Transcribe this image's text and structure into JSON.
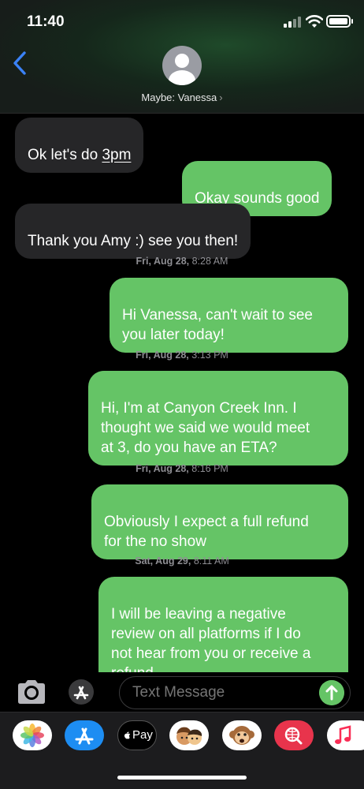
{
  "status_bar": {
    "time": "11:40"
  },
  "header": {
    "contact_name": "Maybe: Vanessa",
    "chevron": "›"
  },
  "messages": [
    {
      "direction": "incoming",
      "text": "Ok let's do ",
      "text_link": "3pm"
    },
    {
      "direction": "outgoing",
      "text": "Okay sounds good"
    },
    {
      "direction": "incoming",
      "text": "Thank you Amy :) see you then!"
    },
    {
      "direction": "outgoing",
      "day": "Fri, Aug 28,",
      "time": "8:28 AM",
      "text": "Hi Vanessa, can't wait to see\nyou later today!"
    },
    {
      "direction": "outgoing",
      "day": "Fri, Aug 28,",
      "time": "3:13 PM",
      "text": "Hi, I'm at Canyon Creek Inn. I\nthought we said we would meet\nat 3, do you have an ETA?"
    },
    {
      "direction": "outgoing",
      "day": "Fri, Aug 28,",
      "time": "8:16 PM",
      "text": "Obviously I expect a full refund\nfor the no show"
    },
    {
      "direction": "outgoing",
      "day": "Sat, Aug 29,",
      "time": "8:11 AM",
      "text": "I will be leaving a negative\nreview on all platforms if I do\nnot hear from you or receive a\nrefund"
    }
  ],
  "input": {
    "placeholder": "Text Message"
  },
  "app_drawer": {
    "apps": [
      {
        "icon": "photos-icon"
      },
      {
        "icon": "app-store-icon"
      },
      {
        "icon": "apple-pay-icon",
        "label": "Pay"
      },
      {
        "icon": "memoji-icon"
      },
      {
        "icon": "animoji-icon"
      },
      {
        "icon": "web-search-icon"
      },
      {
        "icon": "music-icon"
      }
    ]
  },
  "colors": {
    "outgoing_bubble": "#65c466",
    "incoming_bubble": "#262628",
    "accent_blue": "#3b82f6",
    "timestamp_gray": "#8e8e93"
  }
}
